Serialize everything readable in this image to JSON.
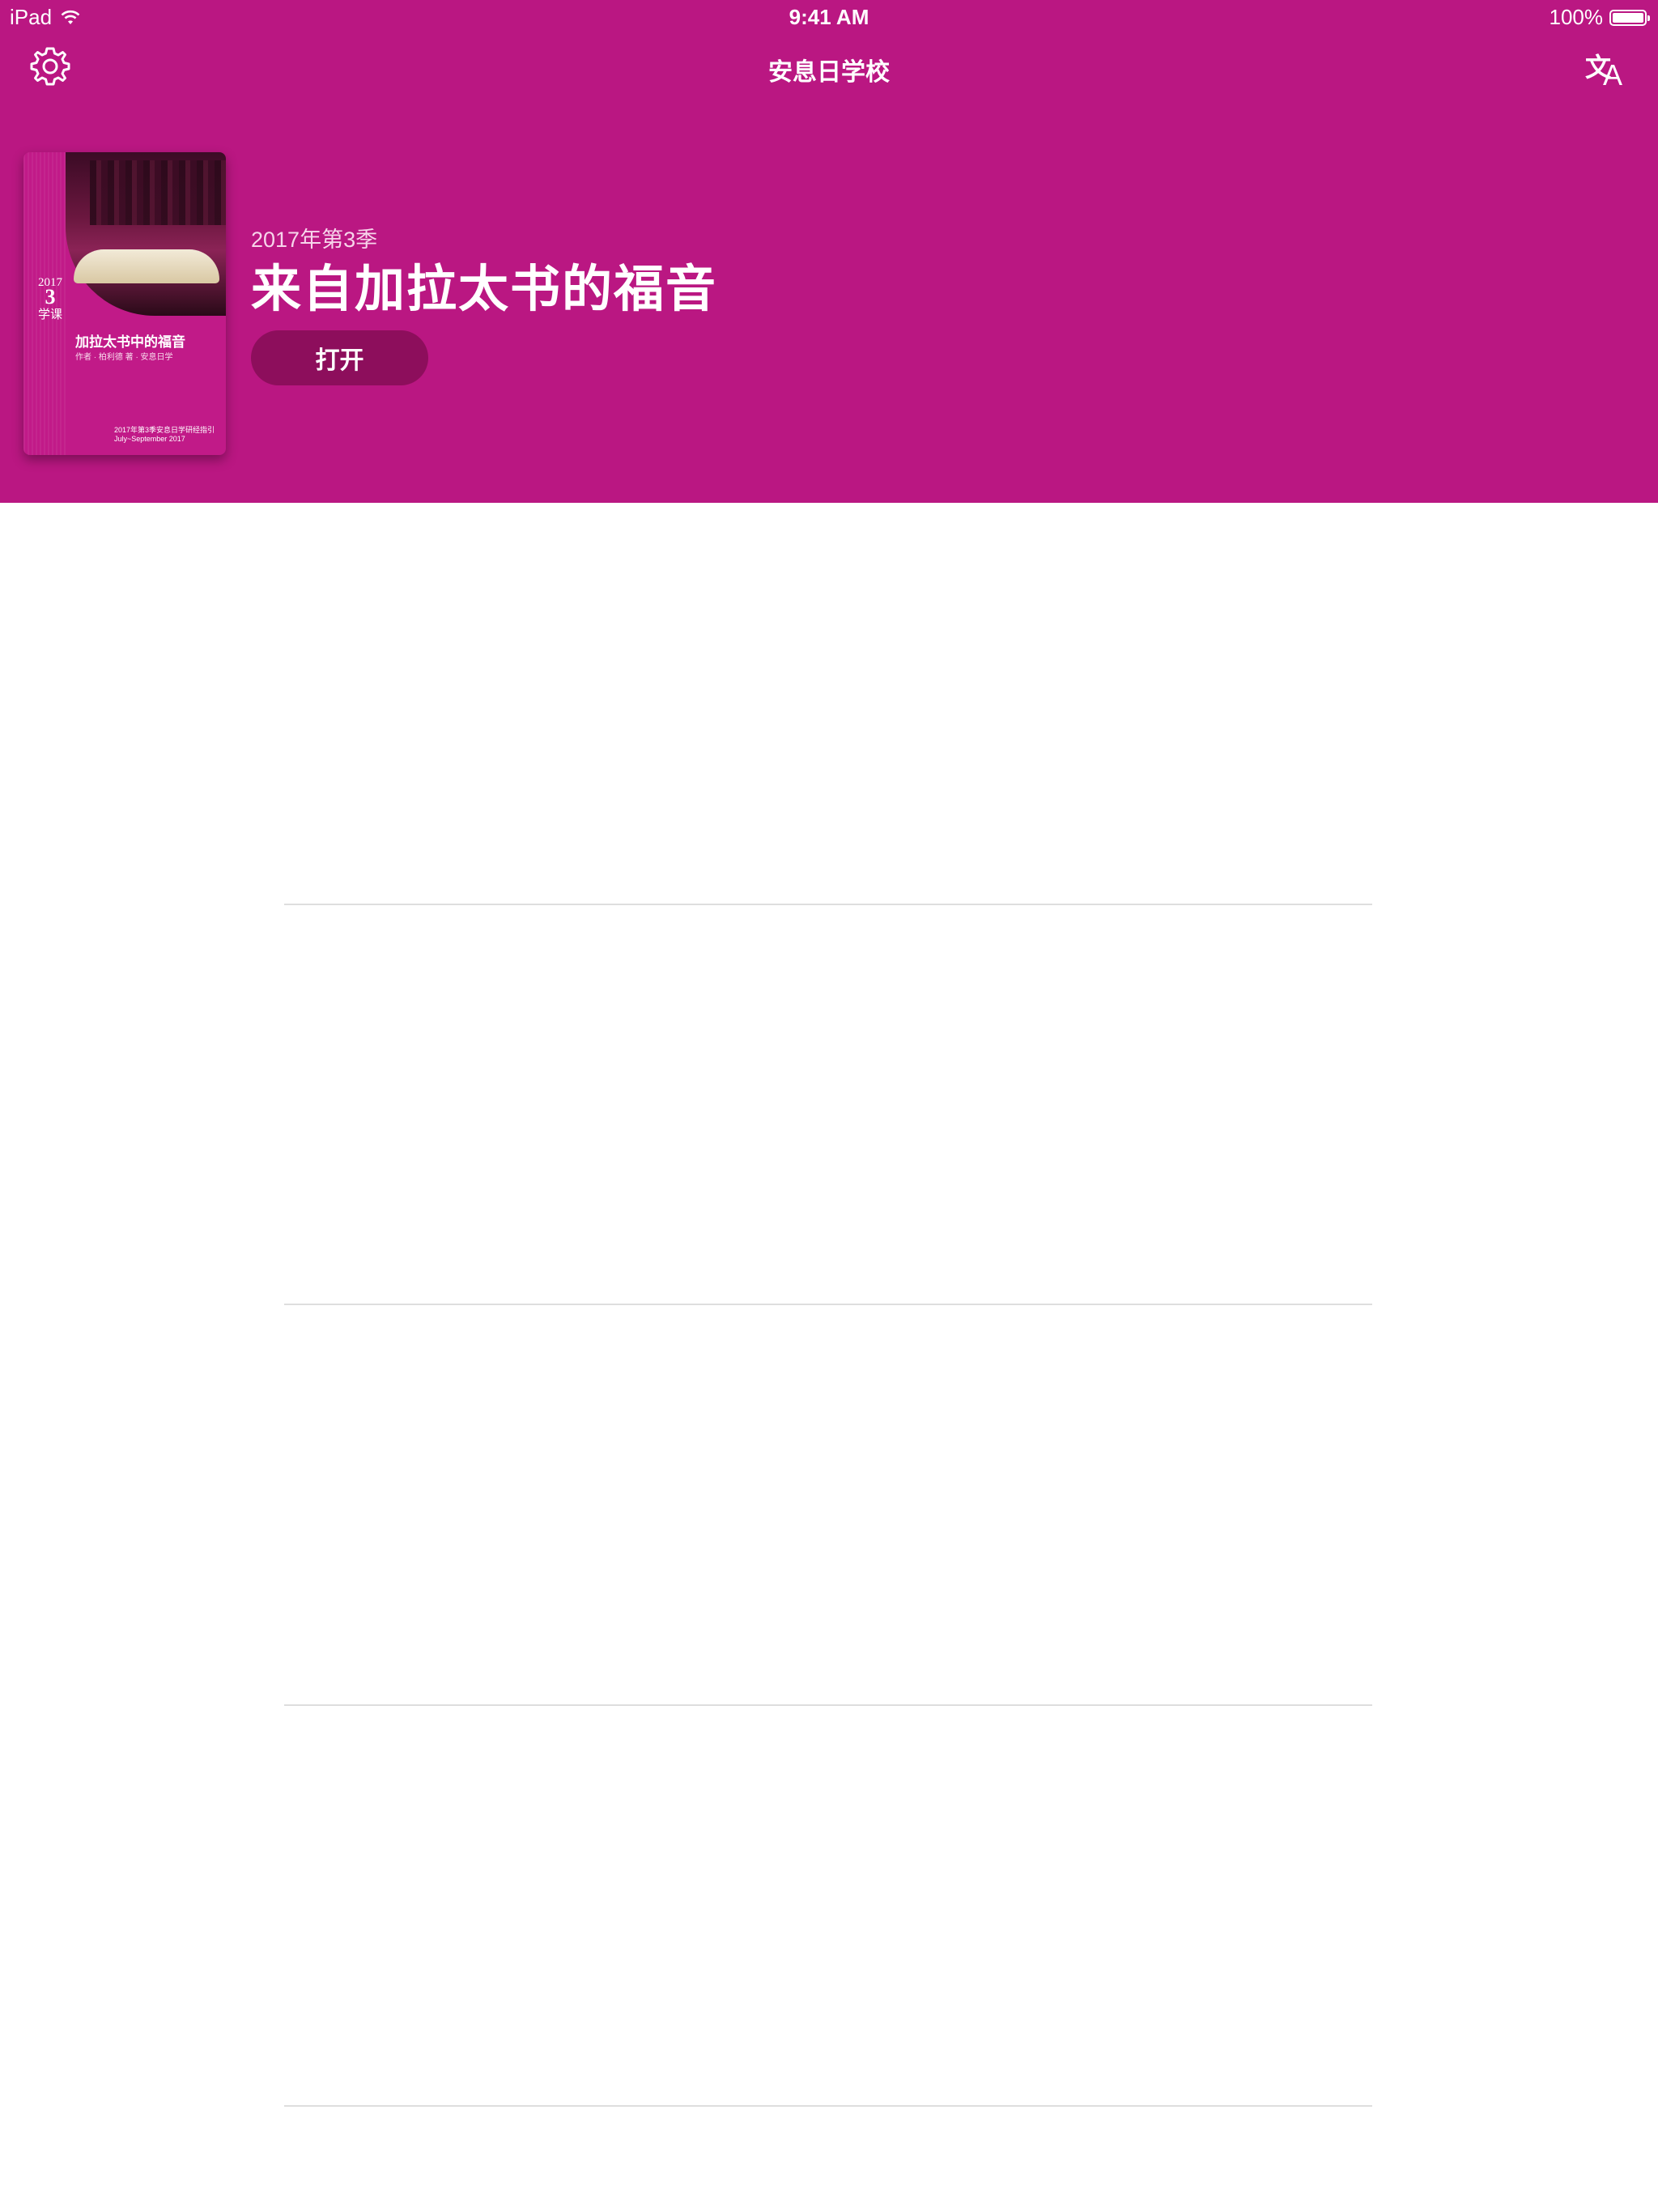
{
  "status_bar": {
    "device": "iPad",
    "time": "9:41 AM",
    "battery": "100%"
  },
  "nav": {
    "title": "安息日学校",
    "settings_icon": "gear-icon",
    "language_icon": "translate-icon",
    "language_glyph_zh": "文",
    "language_glyph_a": "A"
  },
  "featured": {
    "quarter": "2017年第3季",
    "title": "来自加拉太书的福音",
    "open_label": "打开",
    "cover": {
      "title": "加拉太书中的福音",
      "year": "2017",
      "num": "3",
      "label": "学课",
      "subtitle": "作者 · 柏利德 著 · 安息日学",
      "footer_line1": "2017年第3季安息日学研经指引",
      "footer_line2": "July~September 2017"
    }
  },
  "colors": {
    "brand": "#ba1782",
    "button": "#8d0e5c",
    "divider": "#dedede"
  }
}
